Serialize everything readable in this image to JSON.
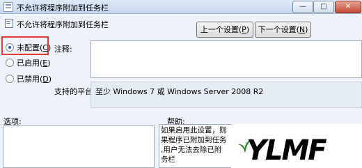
{
  "window": {
    "title": "不允许将程序附加到任务栏",
    "minimize": "—",
    "maximize": "□",
    "close": "✕"
  },
  "policy": {
    "name": "不允许将程序附加到任务栏"
  },
  "nav": {
    "prev_label": "上一个设置(",
    "prev_key": "P",
    "next_label": "下一个设置(",
    "next_key": "N"
  },
  "options": [
    {
      "label": "未配置(",
      "key": "C",
      "selected": true
    },
    {
      "label": "已启用(",
      "key": "E",
      "selected": false
    },
    {
      "label": "已禁用(",
      "key": "D",
      "selected": false
    }
  ],
  "comment": {
    "label": "注释:",
    "value": ""
  },
  "platform": {
    "label": "支持的平台:",
    "value": "至少 Windows 7 或 Windows Server 2008 R2"
  },
  "options_section": {
    "label": "选项:"
  },
  "help_section": {
    "label": "帮助:",
    "lines": [
      "如果启用此设置，则",
      "果程序已附加到任务",
      ",用户无法去除已附",
      "务栏"
    ]
  },
  "watermark": {
    "text": "YLMF",
    "colors": {
      "leaf": "#2f8d2f",
      "text": "#000000"
    }
  }
}
